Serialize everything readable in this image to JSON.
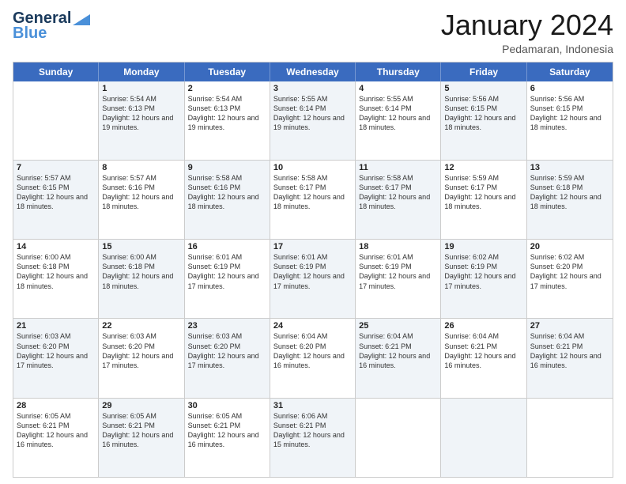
{
  "logo": {
    "general": "General",
    "blue": "Blue"
  },
  "title": "January 2024",
  "location": "Pedamaran, Indonesia",
  "weekdays": [
    "Sunday",
    "Monday",
    "Tuesday",
    "Wednesday",
    "Thursday",
    "Friday",
    "Saturday"
  ],
  "weeks": [
    [
      {
        "day": "",
        "sunrise": "",
        "sunset": "",
        "daylight": "",
        "empty": true
      },
      {
        "day": "1",
        "sunrise": "Sunrise: 5:54 AM",
        "sunset": "Sunset: 6:13 PM",
        "daylight": "Daylight: 12 hours and 19 minutes.",
        "empty": false,
        "alt": true
      },
      {
        "day": "2",
        "sunrise": "Sunrise: 5:54 AM",
        "sunset": "Sunset: 6:13 PM",
        "daylight": "Daylight: 12 hours and 19 minutes.",
        "empty": false,
        "alt": false
      },
      {
        "day": "3",
        "sunrise": "Sunrise: 5:55 AM",
        "sunset": "Sunset: 6:14 PM",
        "daylight": "Daylight: 12 hours and 19 minutes.",
        "empty": false,
        "alt": true
      },
      {
        "day": "4",
        "sunrise": "Sunrise: 5:55 AM",
        "sunset": "Sunset: 6:14 PM",
        "daylight": "Daylight: 12 hours and 18 minutes.",
        "empty": false,
        "alt": false
      },
      {
        "day": "5",
        "sunrise": "Sunrise: 5:56 AM",
        "sunset": "Sunset: 6:15 PM",
        "daylight": "Daylight: 12 hours and 18 minutes.",
        "empty": false,
        "alt": true
      },
      {
        "day": "6",
        "sunrise": "Sunrise: 5:56 AM",
        "sunset": "Sunset: 6:15 PM",
        "daylight": "Daylight: 12 hours and 18 minutes.",
        "empty": false,
        "alt": false
      }
    ],
    [
      {
        "day": "7",
        "sunrise": "Sunrise: 5:57 AM",
        "sunset": "Sunset: 6:15 PM",
        "daylight": "Daylight: 12 hours and 18 minutes.",
        "empty": false,
        "alt": true
      },
      {
        "day": "8",
        "sunrise": "Sunrise: 5:57 AM",
        "sunset": "Sunset: 6:16 PM",
        "daylight": "Daylight: 12 hours and 18 minutes.",
        "empty": false,
        "alt": false
      },
      {
        "day": "9",
        "sunrise": "Sunrise: 5:58 AM",
        "sunset": "Sunset: 6:16 PM",
        "daylight": "Daylight: 12 hours and 18 minutes.",
        "empty": false,
        "alt": true
      },
      {
        "day": "10",
        "sunrise": "Sunrise: 5:58 AM",
        "sunset": "Sunset: 6:17 PM",
        "daylight": "Daylight: 12 hours and 18 minutes.",
        "empty": false,
        "alt": false
      },
      {
        "day": "11",
        "sunrise": "Sunrise: 5:58 AM",
        "sunset": "Sunset: 6:17 PM",
        "daylight": "Daylight: 12 hours and 18 minutes.",
        "empty": false,
        "alt": true
      },
      {
        "day": "12",
        "sunrise": "Sunrise: 5:59 AM",
        "sunset": "Sunset: 6:17 PM",
        "daylight": "Daylight: 12 hours and 18 minutes.",
        "empty": false,
        "alt": false
      },
      {
        "day": "13",
        "sunrise": "Sunrise: 5:59 AM",
        "sunset": "Sunset: 6:18 PM",
        "daylight": "Daylight: 12 hours and 18 minutes.",
        "empty": false,
        "alt": true
      }
    ],
    [
      {
        "day": "14",
        "sunrise": "Sunrise: 6:00 AM",
        "sunset": "Sunset: 6:18 PM",
        "daylight": "Daylight: 12 hours and 18 minutes.",
        "empty": false,
        "alt": false
      },
      {
        "day": "15",
        "sunrise": "Sunrise: 6:00 AM",
        "sunset": "Sunset: 6:18 PM",
        "daylight": "Daylight: 12 hours and 18 minutes.",
        "empty": false,
        "alt": true
      },
      {
        "day": "16",
        "sunrise": "Sunrise: 6:01 AM",
        "sunset": "Sunset: 6:19 PM",
        "daylight": "Daylight: 12 hours and 17 minutes.",
        "empty": false,
        "alt": false
      },
      {
        "day": "17",
        "sunrise": "Sunrise: 6:01 AM",
        "sunset": "Sunset: 6:19 PM",
        "daylight": "Daylight: 12 hours and 17 minutes.",
        "empty": false,
        "alt": true
      },
      {
        "day": "18",
        "sunrise": "Sunrise: 6:01 AM",
        "sunset": "Sunset: 6:19 PM",
        "daylight": "Daylight: 12 hours and 17 minutes.",
        "empty": false,
        "alt": false
      },
      {
        "day": "19",
        "sunrise": "Sunrise: 6:02 AM",
        "sunset": "Sunset: 6:19 PM",
        "daylight": "Daylight: 12 hours and 17 minutes.",
        "empty": false,
        "alt": true
      },
      {
        "day": "20",
        "sunrise": "Sunrise: 6:02 AM",
        "sunset": "Sunset: 6:20 PM",
        "daylight": "Daylight: 12 hours and 17 minutes.",
        "empty": false,
        "alt": false
      }
    ],
    [
      {
        "day": "21",
        "sunrise": "Sunrise: 6:03 AM",
        "sunset": "Sunset: 6:20 PM",
        "daylight": "Daylight: 12 hours and 17 minutes.",
        "empty": false,
        "alt": true
      },
      {
        "day": "22",
        "sunrise": "Sunrise: 6:03 AM",
        "sunset": "Sunset: 6:20 PM",
        "daylight": "Daylight: 12 hours and 17 minutes.",
        "empty": false,
        "alt": false
      },
      {
        "day": "23",
        "sunrise": "Sunrise: 6:03 AM",
        "sunset": "Sunset: 6:20 PM",
        "daylight": "Daylight: 12 hours and 17 minutes.",
        "empty": false,
        "alt": true
      },
      {
        "day": "24",
        "sunrise": "Sunrise: 6:04 AM",
        "sunset": "Sunset: 6:20 PM",
        "daylight": "Daylight: 12 hours and 16 minutes.",
        "empty": false,
        "alt": false
      },
      {
        "day": "25",
        "sunrise": "Sunrise: 6:04 AM",
        "sunset": "Sunset: 6:21 PM",
        "daylight": "Daylight: 12 hours and 16 minutes.",
        "empty": false,
        "alt": true
      },
      {
        "day": "26",
        "sunrise": "Sunrise: 6:04 AM",
        "sunset": "Sunset: 6:21 PM",
        "daylight": "Daylight: 12 hours and 16 minutes.",
        "empty": false,
        "alt": false
      },
      {
        "day": "27",
        "sunrise": "Sunrise: 6:04 AM",
        "sunset": "Sunset: 6:21 PM",
        "daylight": "Daylight: 12 hours and 16 minutes.",
        "empty": false,
        "alt": true
      }
    ],
    [
      {
        "day": "28",
        "sunrise": "Sunrise: 6:05 AM",
        "sunset": "Sunset: 6:21 PM",
        "daylight": "Daylight: 12 hours and 16 minutes.",
        "empty": false,
        "alt": false
      },
      {
        "day": "29",
        "sunrise": "Sunrise: 6:05 AM",
        "sunset": "Sunset: 6:21 PM",
        "daylight": "Daylight: 12 hours and 16 minutes.",
        "empty": false,
        "alt": true
      },
      {
        "day": "30",
        "sunrise": "Sunrise: 6:05 AM",
        "sunset": "Sunset: 6:21 PM",
        "daylight": "Daylight: 12 hours and 16 minutes.",
        "empty": false,
        "alt": false
      },
      {
        "day": "31",
        "sunrise": "Sunrise: 6:06 AM",
        "sunset": "Sunset: 6:21 PM",
        "daylight": "Daylight: 12 hours and 15 minutes.",
        "empty": false,
        "alt": true
      },
      {
        "day": "",
        "sunrise": "",
        "sunset": "",
        "daylight": "",
        "empty": true,
        "alt": false
      },
      {
        "day": "",
        "sunrise": "",
        "sunset": "",
        "daylight": "",
        "empty": true,
        "alt": true
      },
      {
        "day": "",
        "sunrise": "",
        "sunset": "",
        "daylight": "",
        "empty": true,
        "alt": false
      }
    ]
  ]
}
